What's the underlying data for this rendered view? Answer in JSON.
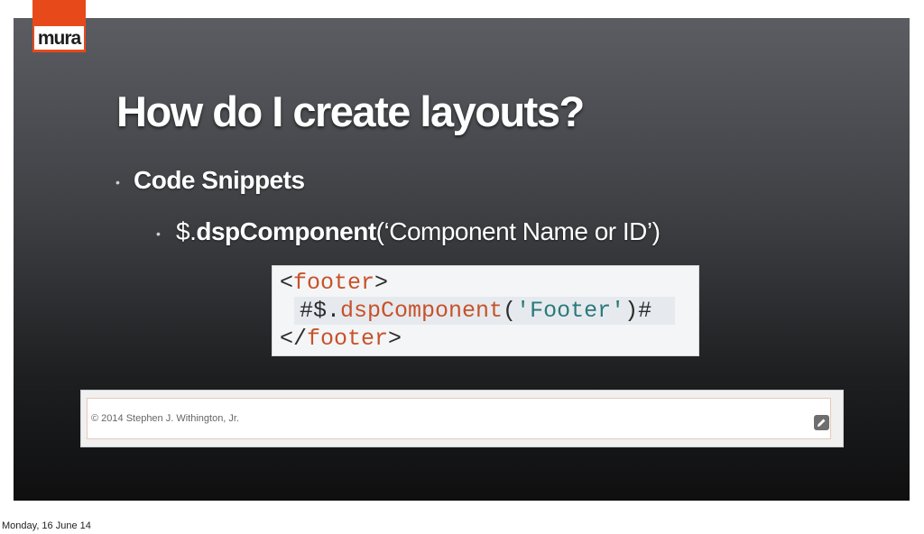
{
  "slide": {
    "logo_text": "mura",
    "title": "How do I create layouts?",
    "bullets": {
      "b1": "Code Snippets",
      "b2_prefix": "$.",
      "b2_bold": "dspComponent",
      "b2_rest": "(‘Component Name or ID’)"
    },
    "code": {
      "line1_open": "<",
      "line1_tag": "footer",
      "line1_close": ">",
      "line2_hash1": "#$.",
      "line2_fn": "dspComponent",
      "line2_paren_open": "(",
      "line2_str": "'Footer'",
      "line2_paren_close": ")#",
      "line3_open": "</",
      "line3_tag": "footer",
      "line3_close": ">"
    },
    "footer_preview": {
      "copyright": "© 2014 Stephen J. Withington, Jr."
    }
  },
  "date_label": "Monday, 16 June 14",
  "icons": {
    "edit": "pencil-icon"
  },
  "colors": {
    "logo": "#e8491b",
    "code_tag": "#c7522a",
    "code_string": "#2a7a7a"
  }
}
